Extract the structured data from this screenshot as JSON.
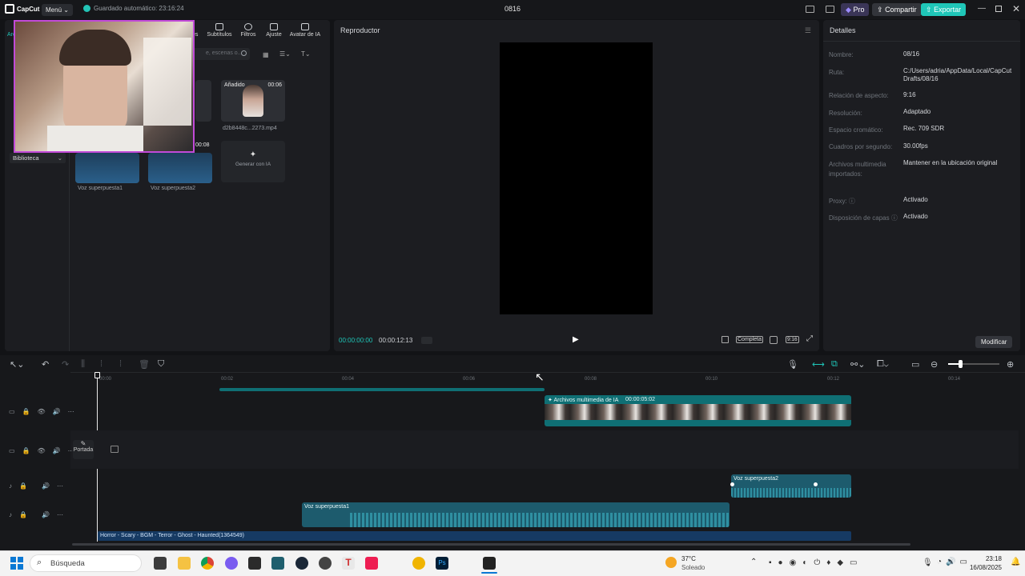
{
  "titlebar": {
    "logo": "CapCut",
    "menu": "Menú ⌄",
    "autosave": "Guardado automático: 23:16:24",
    "project": "0816",
    "pro": "Pro",
    "share": "Compartir",
    "export": "Exportar"
  },
  "media_panel": {
    "tabs": [
      "Subtítulos",
      "Filtros",
      "Ajuste",
      "Avatar de IA"
    ],
    "tab_partial": "es",
    "search_placeholder": "e, escenas o...",
    "sidebar_partial": "Arc",
    "library": "Biblioteca",
    "added_badge": "Añadido",
    "clip_duration": "00:06",
    "clip_name": "d2b8448c...2273.mp4",
    "generate_label": "Generar con IA",
    "voice1": "Voz superpuesta1",
    "voice2": "Voz superpuesta2",
    "voice_duration_partial": "00:08"
  },
  "player": {
    "title": "Reproductor",
    "current_time": "00:00:00:00",
    "total_time": "00:00:12:13",
    "full_label": "Completa",
    "ratio_label": "9:16"
  },
  "details": {
    "title": "Detalles",
    "rows": [
      {
        "label": "Nombre:",
        "value": "08/16"
      },
      {
        "label": "Ruta:",
        "value": "C:/Users/adria/AppData/Local/CapCut Drafts/08/16"
      },
      {
        "label": "Relación de aspecto:",
        "value": "9:16"
      },
      {
        "label": "Resolución:",
        "value": "Adaptado"
      },
      {
        "label": "Espacio cromático:",
        "value": "Rec. 709 SDR"
      },
      {
        "label": "Cuadros por segundo:",
        "value": "30.00fps"
      },
      {
        "label": "Archivos multimedia importados:",
        "value": "Mantener en la ubicación original"
      },
      {
        "label": "Proxy: ⓘ",
        "value": "Activado"
      },
      {
        "label": "Disposición de capas ⓘ",
        "value": "Activado"
      }
    ],
    "modify": "Modificar"
  },
  "timeline": {
    "ruler": [
      "00:00",
      "00:02",
      "00:04",
      "00:06",
      "00:08",
      "00:10",
      "00:12",
      "00:14"
    ],
    "cover": "Portada",
    "ai_clip": "Archivos multimedia de IA",
    "ai_clip_duration": "00:00:05:02",
    "voice1": "Voz superpuesta1",
    "voice2": "Voz superpuesta2",
    "music": "Horror - Scary - BGM - Terror - Ghost - Haunted(1364549)"
  },
  "taskbar": {
    "search": "Búsqueda",
    "temp": "37°C",
    "weather": "Soleado",
    "time": "23:18",
    "date": "16/08/2025"
  },
  "colors": {
    "accent": "#1fc6b8",
    "clip_teal": "#0f6f74",
    "audio_teal": "#1d5b6d",
    "music_blue": "#163a63",
    "pro_purple": "#5b4bd6"
  }
}
